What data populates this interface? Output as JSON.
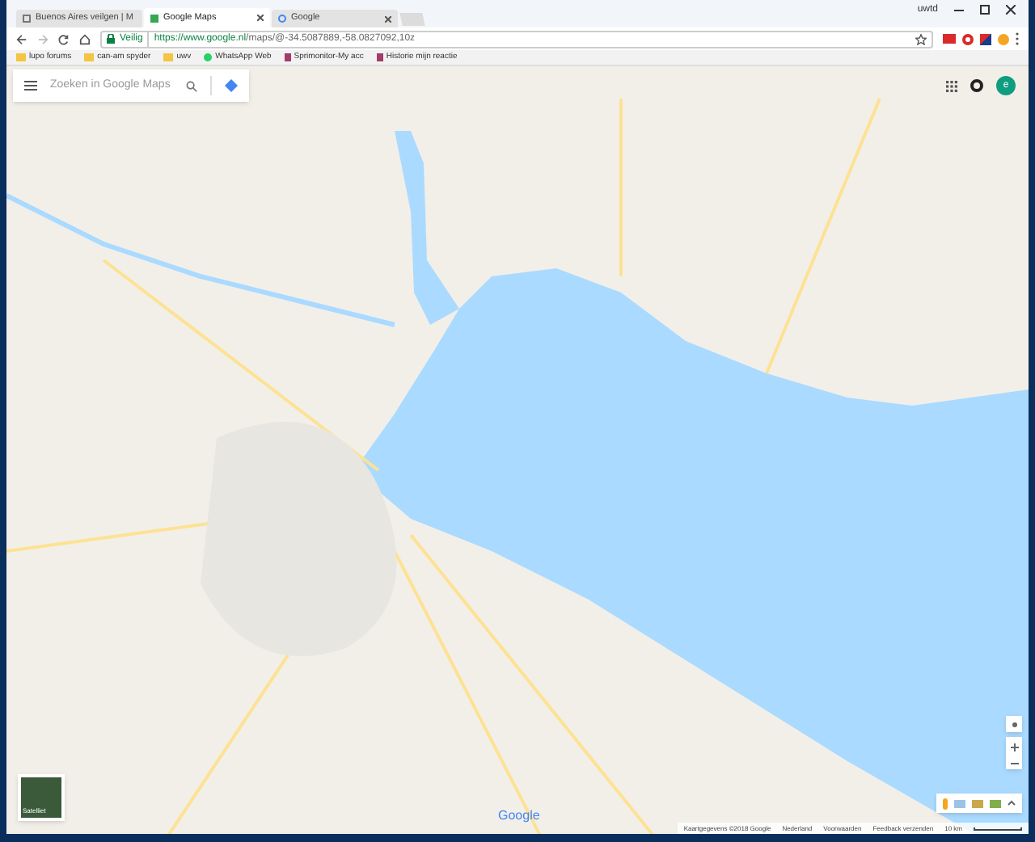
{
  "window": {
    "user": "uwtd"
  },
  "tabs": [
    {
      "title": "Buenos Aires veilgen | M",
      "selected": false
    },
    {
      "title": "Google Maps",
      "selected": true
    },
    {
      "title": "Google",
      "selected": false
    }
  ],
  "address_bar": {
    "security": "Veilig",
    "url_host": "https://www.google.nl",
    "url_path": "/maps/@-34.5087889,-58.0827092,10z"
  },
  "bookmarks": [
    {
      "label": "lupo forums",
      "kind": "folder"
    },
    {
      "label": "can-am spyder",
      "kind": "folder"
    },
    {
      "label": "uwv",
      "kind": "folder"
    },
    {
      "label": "WhatsApp Web",
      "kind": "whatsapp"
    },
    {
      "label": "Sprimonitor-My acc",
      "kind": "page"
    },
    {
      "label": "Historie mijn reactie",
      "kind": "page"
    }
  ],
  "map": {
    "search": {
      "placeholder": "Zoeken in Google Maps"
    },
    "account_initial": "e",
    "layer_button": "Satelliet",
    "logo": "Google",
    "footer": [
      "Kaartgegevens ©2018 Google",
      "Nederland",
      "Voorwaarden",
      "Feedback verzenden"
    ],
    "scale": "10 km"
  }
}
